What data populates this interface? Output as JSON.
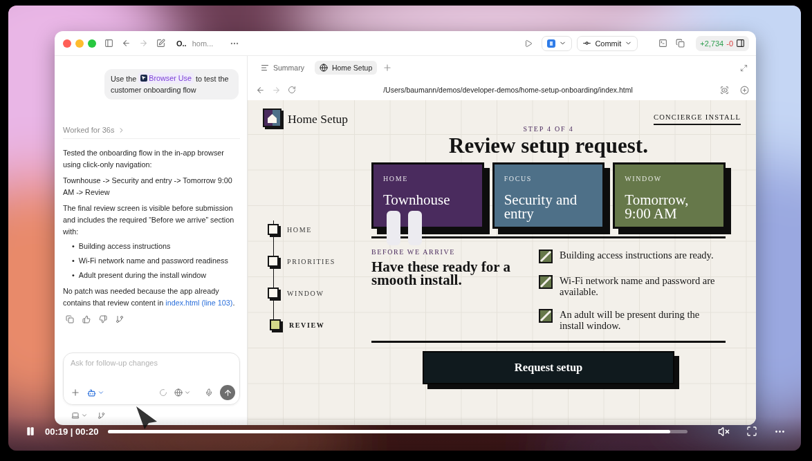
{
  "video": {
    "time": "00:19 | 00:20",
    "level": 0.97
  },
  "titlebar": {
    "thread": "O..",
    "project": "hom...",
    "commit": "Commit",
    "diff_added": "+2,734",
    "diff_removed": "-0"
  },
  "chat": {
    "user_message": {
      "before": "Use the",
      "chip": "Browser Use",
      "after": "to test the customer onboarding flow"
    },
    "worked": "Worked for 36s",
    "paragraphs": [
      "Tested the onboarding flow in the in-app browser using click-only navigation:",
      "Townhouse -> Security and entry -> Tomorrow 9:00 AM -> Review",
      "The final review screen is visible before submission and includes the required “Before we arrive” section with:"
    ],
    "bullets": [
      {
        "marker": "•",
        "text": "Building access instructions"
      },
      {
        "marker": "•",
        "text": "Wi-Fi network name and password readiness"
      },
      {
        "marker": "•",
        "text": "Adult present during the install window"
      }
    ],
    "closing": {
      "text": "No patch was needed because the app already contains that review content in",
      "link": "index.html (line 103)",
      "end": "."
    },
    "composer": {
      "placeholder": "Ask for follow-up changes"
    }
  },
  "browser": {
    "tabs": [
      {
        "label": "Summary",
        "kind": "summary",
        "selected": false
      },
      {
        "label": "Home Setup",
        "kind": "web",
        "selected": true
      }
    ],
    "url": "/Users/baumann/demos/developer-demos/home-setup-onboarding/index.html"
  },
  "page": {
    "brand": "Home Setup",
    "concierge": "CONCIERGE INSTALL",
    "step": "STEP 4 OF 4",
    "title": "Review setup request.",
    "steps": [
      {
        "label": "HOME",
        "selected": false
      },
      {
        "label": "PRIORITIES",
        "selected": false
      },
      {
        "label": "WINDOW",
        "selected": false
      },
      {
        "label": "REVIEW",
        "selected": true
      }
    ],
    "cards": [
      {
        "label": "HOME",
        "value": "Townhouse",
        "color": "#4a2b5e"
      },
      {
        "label": "FOCUS",
        "value": "Security and entry",
        "color": "#4e7088"
      },
      {
        "label": "WINDOW",
        "value": "Tomorrow, 9:00 AM",
        "color": "#66784a"
      }
    ],
    "section_label": "BEFORE WE ARRIVE",
    "section_title": "Have these ready for a smooth install.",
    "checklist": [
      {
        "text": "Building access instructions are ready.",
        "checked": true
      },
      {
        "text": "Wi-Fi network name and password are available.",
        "checked": true
      },
      {
        "text": "An adult will be present during the install window.",
        "checked": true
      }
    ],
    "button": "Request setup"
  }
}
